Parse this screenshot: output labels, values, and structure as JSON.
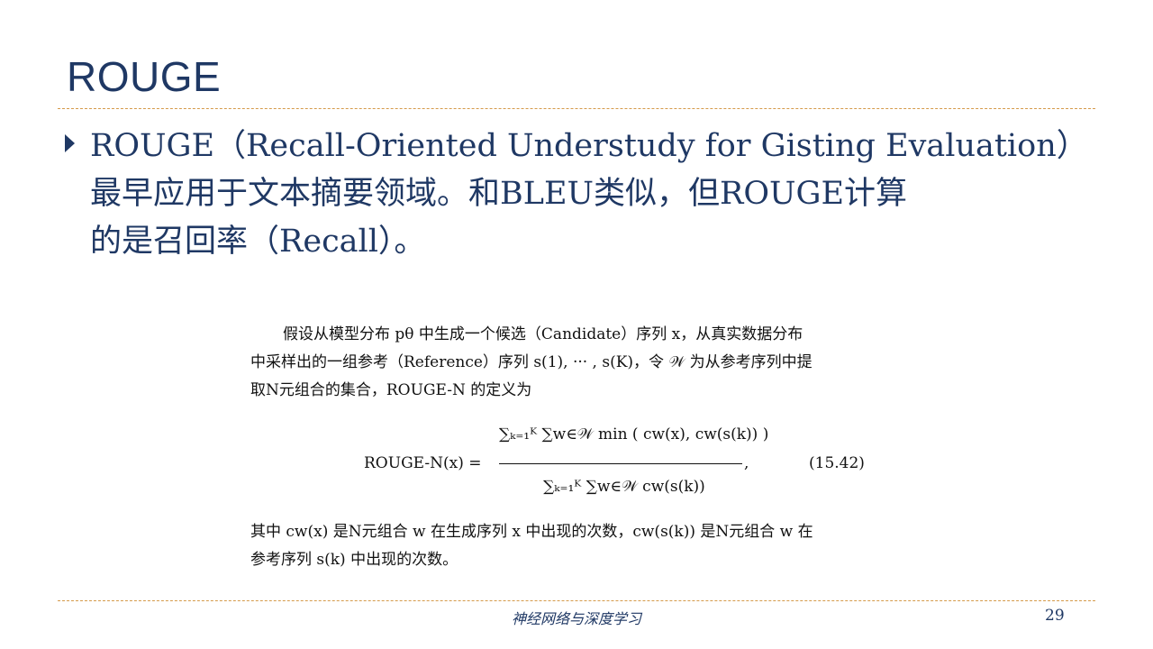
{
  "slide": {
    "title": "ROUGE",
    "bullet": {
      "line1": "ROUGE（Recall-Oriented Understudy for Gisting Evaluation）",
      "line2": "最早应用于文本摘要领域。和BLEU类似，但ROUGE计算",
      "line3": "的是召回率（Recall）。"
    }
  },
  "excerpt": {
    "para1_line1": "假设从模型分布 pθ 中生成一个候选（Candidate）序列 x，从真实数据分布",
    "para1_line2": "中采样出的一组参考（Reference）序列 s(1), ··· , s(K)，令 𝒲 为从参考序列中提",
    "para1_line3": "取N元组合的集合，ROUGE-N 的定义为",
    "formula_lhs": "ROUGE-N(x) =",
    "formula_numerator": "∑ₖ₌₁ᴷ ∑w∈𝒲 min ( cw(x), cw(s(k)) )",
    "formula_denominator": "∑ₖ₌₁ᴷ ∑w∈𝒲 cw(s(k))",
    "formula_comma": ",",
    "equation_number": "(15.42)",
    "para2_line1": "其中 cw(x) 是N元组合 w 在生成序列 x 中出现的次数，cw(s(k)) 是N元组合 w 在",
    "para2_line2": "参考序列 s(k) 中出现的次数。"
  },
  "footer": {
    "book_title": "神经网络与深度学习",
    "page_number": "29"
  }
}
